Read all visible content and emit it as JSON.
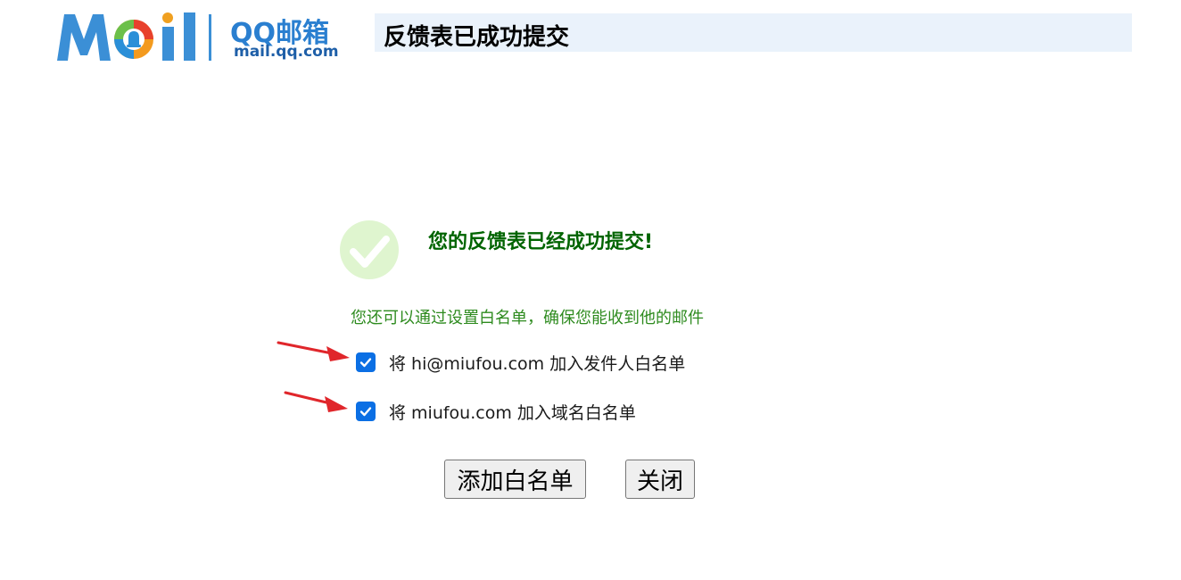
{
  "header": {
    "logo_text": "Mail",
    "logo_qq": "QQ邮箱",
    "logo_domain": "mail.qq.com",
    "title": "反馈表已成功提交"
  },
  "success": {
    "icon": "check-circle-icon",
    "title": "您的反馈表已经成功提交!",
    "hint": "您还可以通过设置白名单，确保您能收到他的邮件"
  },
  "options": [
    {
      "label": "将 hi@miufou.com 加入发件人白名单",
      "checked": true
    },
    {
      "label": "将 miufou.com 加入域名白名单",
      "checked": true
    }
  ],
  "buttons": {
    "add_label": "添加白名单",
    "close_label": "关闭"
  },
  "colors": {
    "header_bar": "#eaf2fb",
    "success_title": "#006400",
    "hint": "#2e8b1f",
    "checkbox": "#0b6fe4",
    "annotation_arrow": "#e0262b"
  }
}
